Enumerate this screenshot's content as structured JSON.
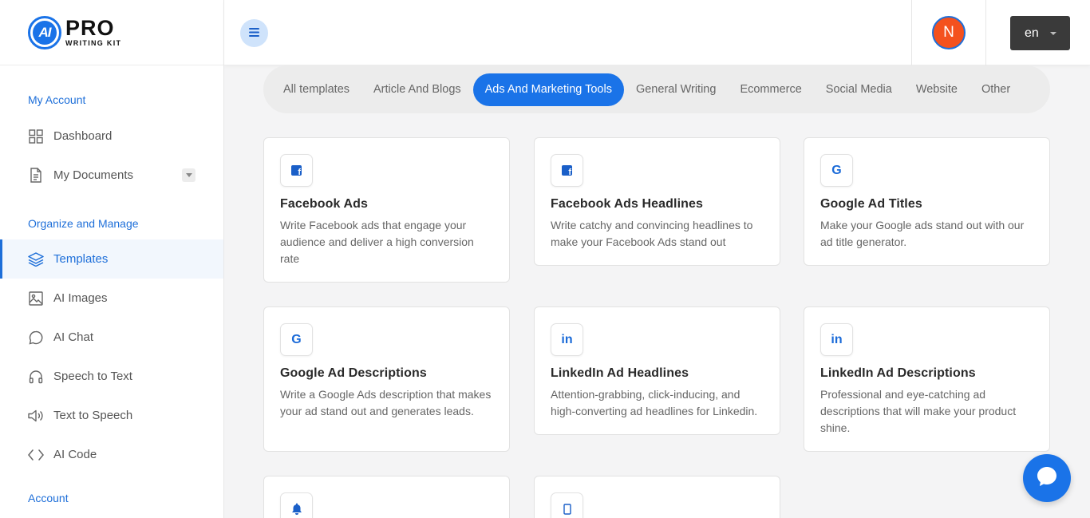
{
  "brand": {
    "logo_mark": "AI",
    "name": "PRO",
    "tagline": "WRITING KIT"
  },
  "sidebar": {
    "sections": [
      {
        "title": "My Account"
      },
      {
        "title": "Organize and Manage"
      },
      {
        "title": "Account"
      }
    ],
    "items": [
      {
        "label": "Dashboard",
        "icon": "grid-icon"
      },
      {
        "label": "My Documents",
        "icon": "document-icon"
      },
      {
        "label": "Templates",
        "icon": "layers-icon",
        "active": true
      },
      {
        "label": "AI Images",
        "icon": "image-icon"
      },
      {
        "label": "AI Chat",
        "icon": "chat-icon"
      },
      {
        "label": "Speech to Text",
        "icon": "headphones-icon"
      },
      {
        "label": "Text to Speech",
        "icon": "speaker-icon"
      },
      {
        "label": "AI Code",
        "icon": "code-icon"
      }
    ]
  },
  "header": {
    "avatar_initial": "N",
    "language": "en"
  },
  "tabs": [
    {
      "label": "All templates"
    },
    {
      "label": "Article And Blogs"
    },
    {
      "label": "Ads And Marketing Tools",
      "active": true
    },
    {
      "label": "General Writing"
    },
    {
      "label": "Ecommerce"
    },
    {
      "label": "Social Media"
    },
    {
      "label": "Website"
    },
    {
      "label": "Other"
    }
  ],
  "cards": [
    {
      "title": "Facebook Ads",
      "description": "Write Facebook ads that engage your audience and deliver a high conversion rate",
      "icon": "facebook-icon"
    },
    {
      "title": "Facebook Ads Headlines",
      "description": "Write catchy and convincing headlines to make your Facebook Ads stand out",
      "icon": "facebook-icon"
    },
    {
      "title": "Google Ad Titles",
      "description": "Make your Google ads stand out with our ad title generator.",
      "icon": "google-icon"
    },
    {
      "title": "Google Ad Descriptions",
      "description": "Write a Google Ads description that makes your ad stand out and generates leads.",
      "icon": "google-icon"
    },
    {
      "title": "LinkedIn Ad Headlines",
      "description": "Attention-grabbing, click-inducing, and high-converting ad headlines for Linkedin.",
      "icon": "linkedin-icon"
    },
    {
      "title": "LinkedIn Ad Descriptions",
      "description": "Professional and eye-catching ad descriptions that will make your product shine.",
      "icon": "linkedin-icon"
    },
    {
      "icon": "bell-icon"
    },
    {
      "icon": "mobile-icon"
    }
  ],
  "colors": {
    "accent": "#1a73e8",
    "avatar": "#f4511e",
    "lang_button": "#3a3a3a"
  }
}
